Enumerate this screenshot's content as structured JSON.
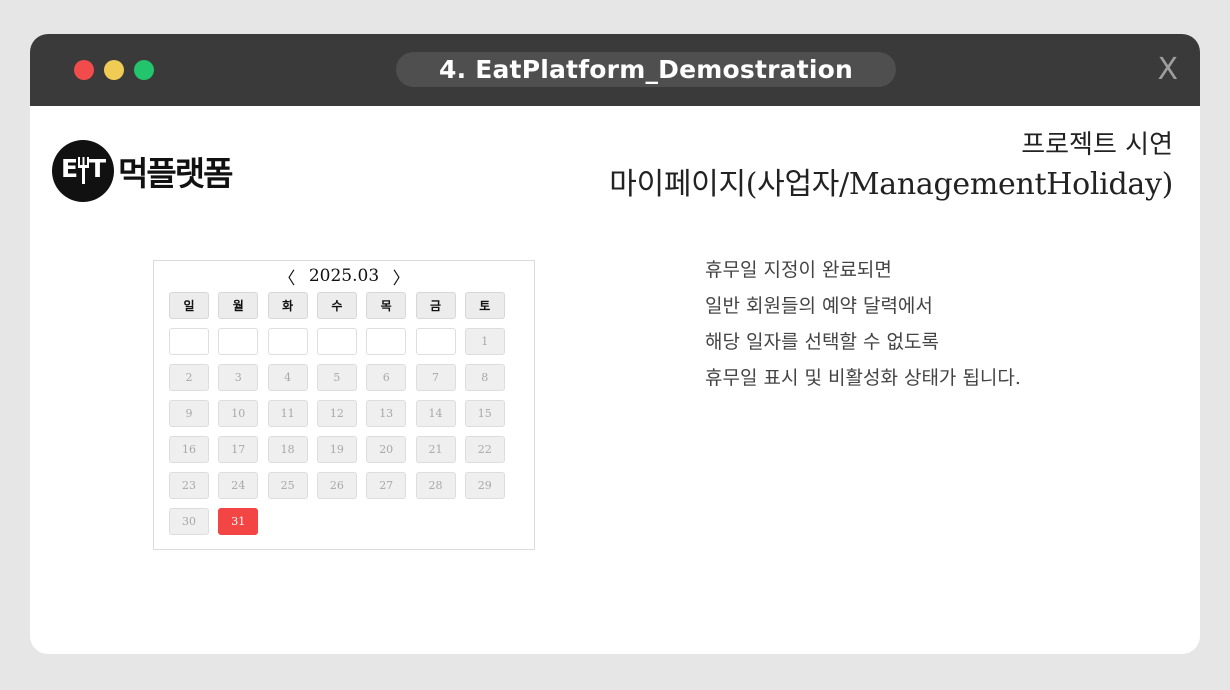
{
  "window": {
    "title": "4. EatPlatform_Demostration",
    "close_label": "X"
  },
  "logo": {
    "circle_left": "E",
    "circle_right": "T",
    "text": "먹플랫폼"
  },
  "header": {
    "subtitle": "프로젝트 시연",
    "title": "마이페이지(사업자/ManagementHoliday)"
  },
  "calendar": {
    "prev_label": "〈",
    "next_label": "〉",
    "month": "2025.03",
    "weekdays": [
      "일",
      "월",
      "화",
      "수",
      "목",
      "금",
      "토"
    ],
    "leading_blanks": 6,
    "days": [
      "1",
      "2",
      "3",
      "4",
      "5",
      "6",
      "7",
      "8",
      "9",
      "10",
      "11",
      "12",
      "13",
      "14",
      "15",
      "16",
      "17",
      "18",
      "19",
      "20",
      "21",
      "22",
      "23",
      "24",
      "25",
      "26",
      "27",
      "28",
      "29",
      "30",
      "31"
    ],
    "selected_day": "31",
    "selected_color": "#f44545"
  },
  "description": {
    "lines": [
      "휴무일 지정이 완료되면",
      "일반 회원들의 예약 달력에서",
      "해당 일자를 선택할 수 없도록",
      "휴무일 표시 및 비활성화 상태가 됩니다."
    ]
  },
  "colors": {
    "titlebar": "#3a3a3a",
    "traffic_red": "#f14b4b",
    "traffic_yellow": "#f0cc55",
    "traffic_green": "#22c56b"
  }
}
